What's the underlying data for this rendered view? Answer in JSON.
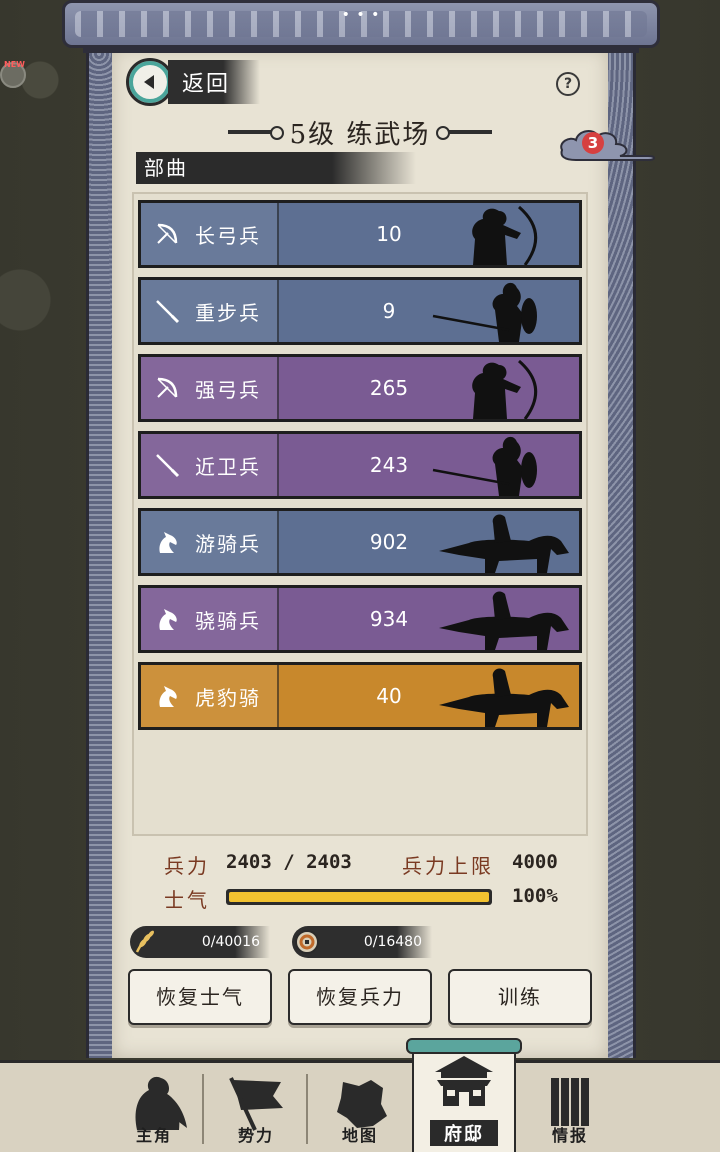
{
  "header": {
    "back_label": "返回",
    "help_label": "?",
    "title": "5级  练武场",
    "cloud_count": "3",
    "section_label": "部曲"
  },
  "units": [
    {
      "name": "长弓兵",
      "count": "10",
      "color": "#5d6f92",
      "icon": "bow-icon",
      "silhouette": "archer"
    },
    {
      "name": "重步兵",
      "count": "9",
      "color": "#5d6f92",
      "icon": "spear-icon",
      "silhouette": "infantry"
    },
    {
      "name": "强弓兵",
      "count": "265",
      "color": "#7a5b93",
      "icon": "bow-icon",
      "silhouette": "archer"
    },
    {
      "name": "近卫兵",
      "count": "243",
      "color": "#7a5b93",
      "icon": "spear-icon",
      "silhouette": "infantry"
    },
    {
      "name": "游骑兵",
      "count": "902",
      "color": "#5d6f92",
      "icon": "horse-icon",
      "silhouette": "cavalry"
    },
    {
      "name": "骁骑兵",
      "count": "934",
      "color": "#7a5b93",
      "icon": "horse-icon",
      "silhouette": "cavalry"
    },
    {
      "name": "虎豹骑",
      "count": "40",
      "color": "#c8882c",
      "icon": "horse-icon",
      "silhouette": "cavalry"
    }
  ],
  "stats": {
    "troops_label": "兵力",
    "troops_value": "2403 / 2403",
    "troop_cap_label": "兵力上限",
    "troop_cap_value": "4000",
    "morale_label": "士气",
    "morale_value": "100%",
    "morale_fraction": 1.0
  },
  "resources": {
    "grain": "0/40016",
    "coin": "0/16480"
  },
  "actions": {
    "restore_morale": "恢复士气",
    "restore_troops": "恢复兵力",
    "train": "训练"
  },
  "nav": {
    "hero": "主角",
    "faction": "势力",
    "map": "地图",
    "mansion": "府邸",
    "intel": "情报"
  },
  "colors": {
    "blue_unit": "#5d6f92",
    "purple_unit": "#7a5b93",
    "gold_unit": "#c8882c",
    "morale_bar": "#f2c230",
    "accent_teal": "#5ba59d"
  }
}
